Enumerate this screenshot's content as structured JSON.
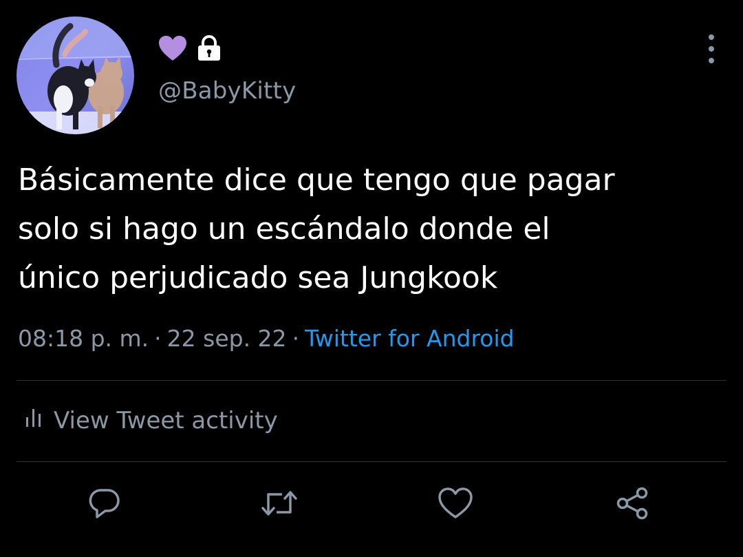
{
  "profile": {
    "avatar_icon": "cats-avatar",
    "name_icons": [
      "purple-heart-icon",
      "lock-icon"
    ],
    "handle": "@BabyKitty"
  },
  "tweet": {
    "text_lines": [
      "Básicamente dice que tengo que pagar",
      "solo si hago un escándalo donde el",
      "único perjudicado sea Jungkook"
    ],
    "time": "08:18 p. m.",
    "separator": "·",
    "date": "22 sep. 22",
    "source": "Twitter for Android"
  },
  "activity": {
    "label": "View Tweet activity",
    "icon": "bar-chart-icon"
  },
  "actions": [
    {
      "name": "reply",
      "icon": "reply-icon"
    },
    {
      "name": "retweet",
      "icon": "retweet-icon"
    },
    {
      "name": "like",
      "icon": "heart-outline-icon"
    },
    {
      "name": "share",
      "icon": "share-icon"
    }
  ],
  "colors": {
    "background": "#000000",
    "text": "#ffffff",
    "muted": "#8b98a5",
    "link": "#1d9bf0",
    "heart": "#b48ee0",
    "divider": "#2f3336"
  }
}
